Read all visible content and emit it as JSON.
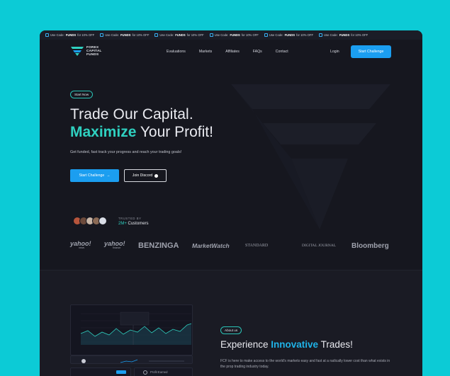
{
  "ticker": {
    "items": [
      {
        "prefix": "Use Code:",
        "code": "FUNDS",
        "suffix": "for 10% OFF"
      },
      {
        "prefix": "Use Code:",
        "code": "FUNDS",
        "suffix": "for 10% OFF"
      },
      {
        "prefix": "Use Code:",
        "code": "FUNDS",
        "suffix": "for 10% OFF"
      },
      {
        "prefix": "Use Code:",
        "code": "FUNDS",
        "suffix": "for 10% OFF"
      },
      {
        "prefix": "Use Code:",
        "code": "FUNDS",
        "suffix": "for 10% OFF"
      },
      {
        "prefix": "Use Code:",
        "code": "FUNDS",
        "suffix": "for 10% OFF"
      }
    ]
  },
  "logo": {
    "line1": "FOREX",
    "line2": "CAPITAL",
    "line3": "FUNDS"
  },
  "nav": {
    "links": [
      "Evaluations",
      "Markets",
      "Affiliates",
      "FAQs",
      "Contact"
    ],
    "login": "Login",
    "cta": "Start Challenge"
  },
  "hero": {
    "pill": "Start Now",
    "line1": "Trade Our Capital.",
    "accent": "Maximize",
    "line2_rest": " Your Profit!",
    "subtitle": "Get funded, fast track your progress and reach your trading goals!",
    "primary_button": "Start Challenge",
    "secondary_button": "Join Discord"
  },
  "trust": {
    "label": "TRUSTED BY",
    "count": "2M+",
    "customers": "Customers"
  },
  "brands": [
    "yahoo!",
    "yahoo!",
    "BENZINGA",
    "MarketWatch",
    "STANDARD",
    "DIGITAL JOURNAL",
    "Bloomberg"
  ],
  "brand_subs": {
    "yahoo1": "news",
    "yahoo2": "finance"
  },
  "about": {
    "pill": "About us",
    "title_pre": "Experience ",
    "title_accent": "Innovative",
    "title_post": " Trades!",
    "text": "FCF is here to make access to the world's markets easy and fast at a radically lower cost than what exists in the prop trading industry today.",
    "card_label": "Profit Earned"
  },
  "colors": {
    "accent_teal": "#2fd0c0",
    "accent_blue": "#1b9ef0",
    "background": "#16171f",
    "frame_bg": "#0ccbd6"
  }
}
